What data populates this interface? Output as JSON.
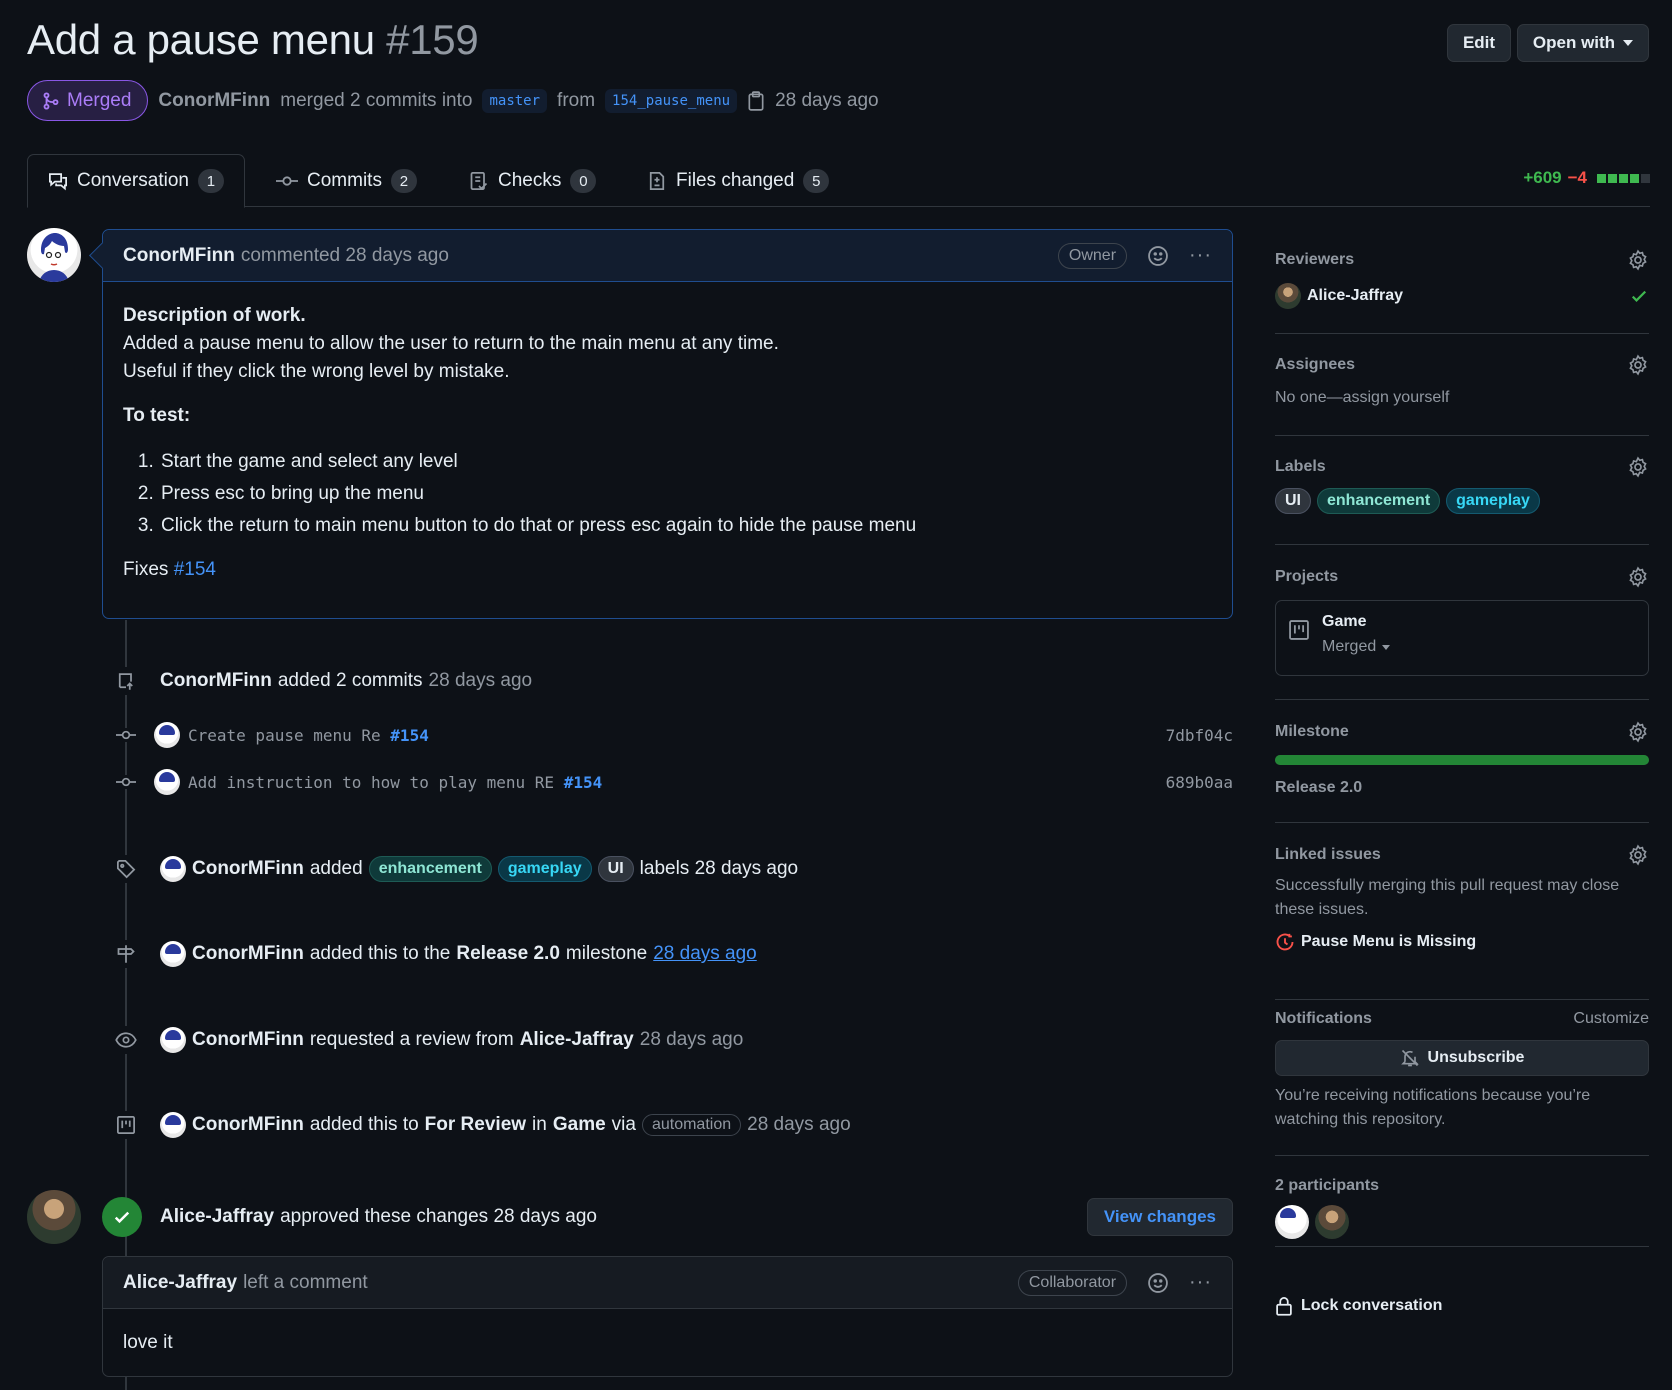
{
  "header": {
    "title": "Add a pause menu",
    "number": "#159",
    "edit_label": "Edit",
    "open_with_label": "Open with",
    "state": "Merged",
    "author": "ConorMFinn",
    "merged_text": "merged 2 commits into",
    "base_branch": "master",
    "from_text": "from",
    "head_branch": "154_pause_menu",
    "time": "28 days ago"
  },
  "tabs": [
    {
      "label": "Conversation",
      "count": "1"
    },
    {
      "label": "Commits",
      "count": "2"
    },
    {
      "label": "Checks",
      "count": "0"
    },
    {
      "label": "Files changed",
      "count": "5"
    }
  ],
  "diffstat": {
    "additions": "+609",
    "deletions": "−4"
  },
  "first_comment": {
    "author": "ConorMFinn",
    "action": "commented 28 days ago",
    "role": "Owner",
    "heading": "Description of work.",
    "line1": "Added a pause menu to allow the user to return to the main menu at any time.",
    "line2": "Useful if they click the wrong level by mistake.",
    "test_heading": "To test:",
    "steps": [
      "Start the game and select any level",
      "Press esc to bring up the menu",
      "Click the return to main menu button to do that or press esc again to hide the pause menu"
    ],
    "fixes_text": "Fixes",
    "fixes_link": "#154"
  },
  "events": {
    "commits_added": {
      "author": "ConorMFinn",
      "text": "added 2 commits",
      "time": "28 days ago"
    },
    "commits": [
      {
        "message": "Create pause menu Re",
        "ref": "#154",
        "sha": "7dbf04c"
      },
      {
        "message": "Add instruction to how to play menu RE",
        "ref": "#154",
        "sha": "689b0aa"
      }
    ],
    "labels_added": {
      "author": "ConorMFinn",
      "text": "added",
      "labels": [
        "enhancement",
        "gameplay",
        "UI"
      ],
      "suffix": "labels 28 days ago"
    },
    "milestone": {
      "author": "ConorMFinn",
      "text": "added this to the",
      "milestone": "Release 2.0",
      "suffix": "milestone",
      "time": "28 days ago"
    },
    "review_request": {
      "author": "ConorMFinn",
      "text": "requested a review from",
      "reviewer": "Alice-Jaffray",
      "time": "28 days ago"
    },
    "project": {
      "author": "ConorMFinn",
      "text": "added this to",
      "column": "For Review",
      "in_text": "in",
      "project": "Game",
      "via_text": "via",
      "via": "automation",
      "time": "28 days ago"
    },
    "approval": {
      "author": "Alice-Jaffray",
      "text": "approved these changes 28 days ago",
      "button": "View changes"
    }
  },
  "second_comment": {
    "author": "Alice-Jaffray",
    "action": "left a comment",
    "role": "Collaborator",
    "body": "love it"
  },
  "sidebar": {
    "reviewers": {
      "heading": "Reviewers",
      "name": "Alice-Jaffray"
    },
    "assignees": {
      "heading": "Assignees",
      "text": "No one—assign yourself"
    },
    "labels": {
      "heading": "Labels",
      "items": [
        "UI",
        "enhancement",
        "gameplay"
      ]
    },
    "projects": {
      "heading": "Projects",
      "name": "Game",
      "status": "Merged"
    },
    "milestone": {
      "heading": "Milestone",
      "name": "Release 2.0",
      "progress": 1.0
    },
    "linked_issues": {
      "heading": "Linked issues",
      "text": "Successfully merging this pull request may close these issues.",
      "issue": "Pause Menu is Missing"
    },
    "notifications": {
      "heading": "Notifications",
      "customize": "Customize",
      "button": "Unsubscribe",
      "text": "You’re receiving notifications because you’re watching this repository."
    },
    "participants": {
      "heading": "2 participants"
    },
    "lock": {
      "label": "Lock conversation"
    }
  },
  "colors": {
    "accent": "#4493f8",
    "merged": "#ab7df8",
    "success": "#238636",
    "background": "#0d1117"
  }
}
